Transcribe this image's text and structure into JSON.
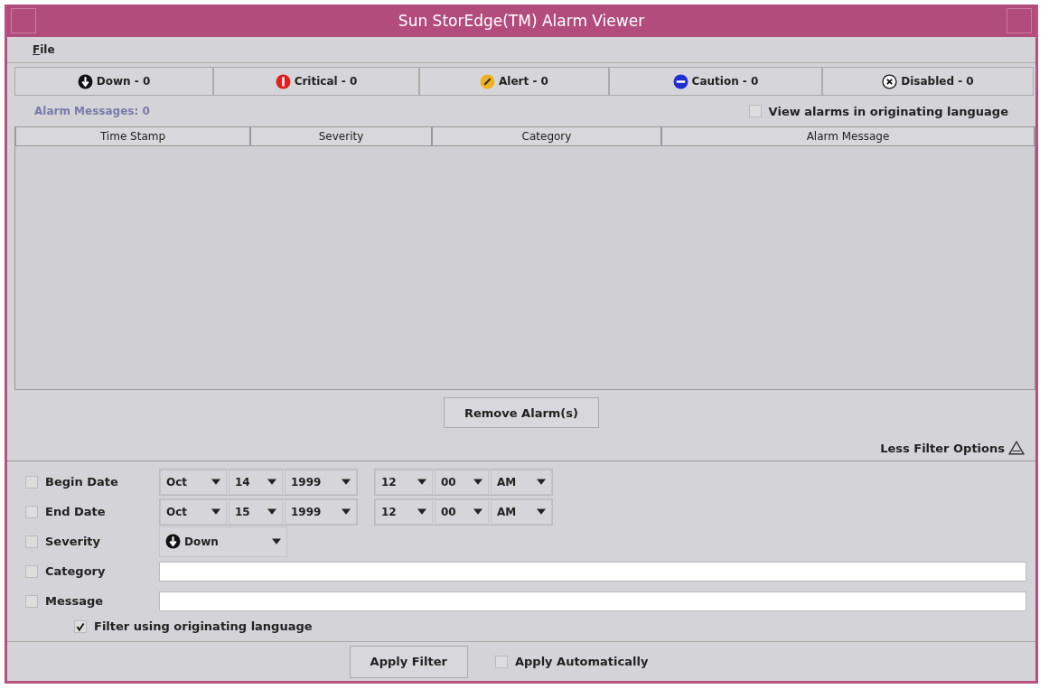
{
  "window": {
    "title": "Sun StorEdge(TM) Alarm Viewer"
  },
  "menu": [
    {
      "label": "File"
    }
  ],
  "severity_tabs": [
    {
      "kind": "down",
      "label": "Down - 0"
    },
    {
      "kind": "critical",
      "label": "Critical - 0"
    },
    {
      "kind": "alert",
      "label": "Alert - 0"
    },
    {
      "kind": "caution",
      "label": "Caution - 0"
    },
    {
      "kind": "disabled",
      "label": "Disabled - 0"
    }
  ],
  "alarm_count": "Alarm Messages: 0",
  "view_original": {
    "label": "View alarms in originating language",
    "checked": false
  },
  "table": {
    "columns": [
      "Time Stamp",
      "Severity",
      "Category",
      "Alarm Message"
    ]
  },
  "remove_button": "Remove Alarm(s)",
  "less_options": "Less Filter Options",
  "filters": [
    {
      "kind": "datetime",
      "label": "Begin Date",
      "checked": false,
      "date": [
        "Oct",
        "14",
        "1999"
      ],
      "time": [
        "12",
        "00",
        "AM"
      ]
    },
    {
      "kind": "datetime",
      "label": "End Date",
      "checked": false,
      "date": [
        "Oct",
        "15",
        "1999"
      ],
      "time": [
        "12",
        "00",
        "AM"
      ]
    },
    {
      "kind": "severity",
      "label": "Severity",
      "checked": false,
      "selection": {
        "kind": "down",
        "label": "Down"
      }
    },
    {
      "kind": "text",
      "label": "Category",
      "checked": false
    },
    {
      "kind": "text",
      "label": "Message",
      "checked": false
    }
  ],
  "filter_language": {
    "label": "Filter using originating language",
    "checked": true
  },
  "apply_button": "Apply Filter",
  "apply_auto": {
    "label": "Apply Automatically",
    "checked": false
  }
}
